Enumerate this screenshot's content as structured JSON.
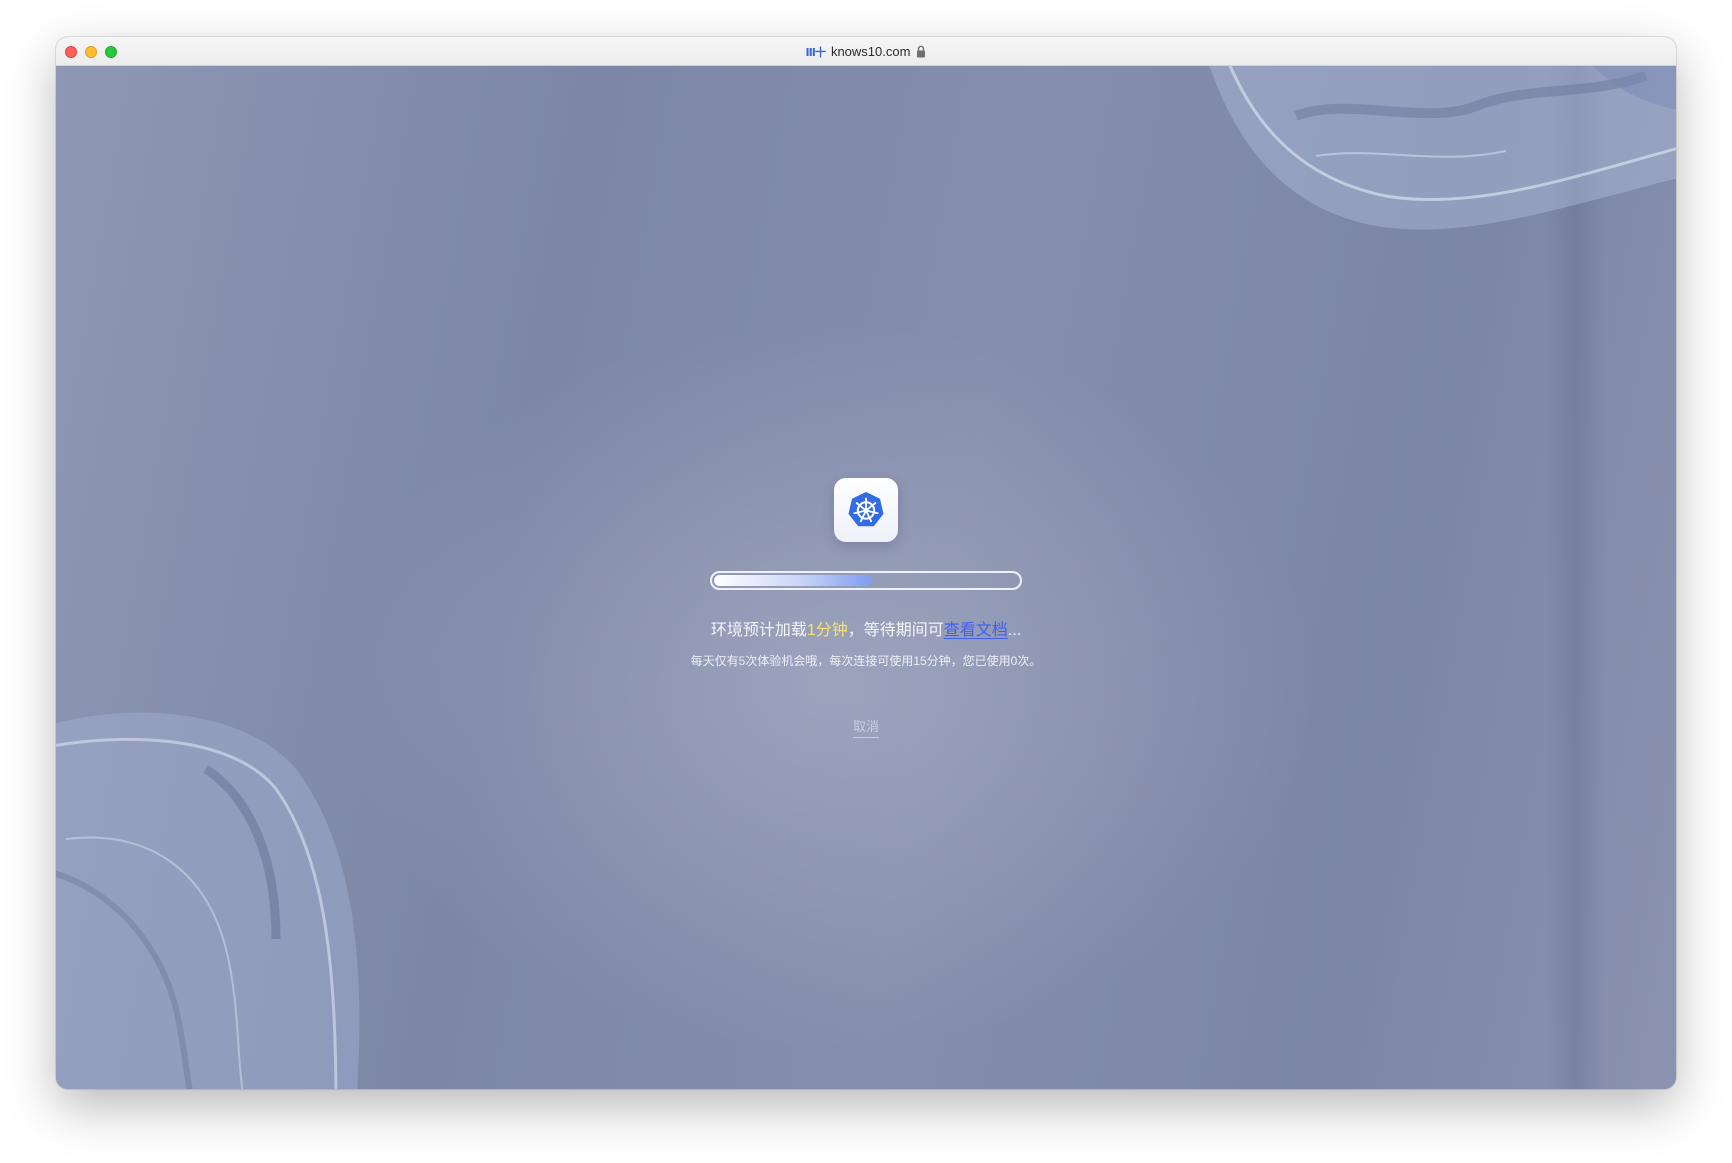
{
  "browser": {
    "site_icon_text": "Ⅲ十",
    "url": "knows10.com"
  },
  "loader": {
    "icon": "kubernetes-icon",
    "progress": 0.52,
    "message_prefix": "环境预计加载",
    "message_highlight": "1分钟",
    "message_middle": "，等待期间可",
    "doc_link": "查看文档",
    "message_suffix": "...",
    "sub_message": "每天仅有5次体验机会哦，每次连接可使用15分钟，您已使用0次。",
    "cancel_label": "取消"
  },
  "colors": {
    "highlight": "#f6e46a",
    "link": "#3f5ff0",
    "kubernetes_blue": "#326ce5"
  }
}
